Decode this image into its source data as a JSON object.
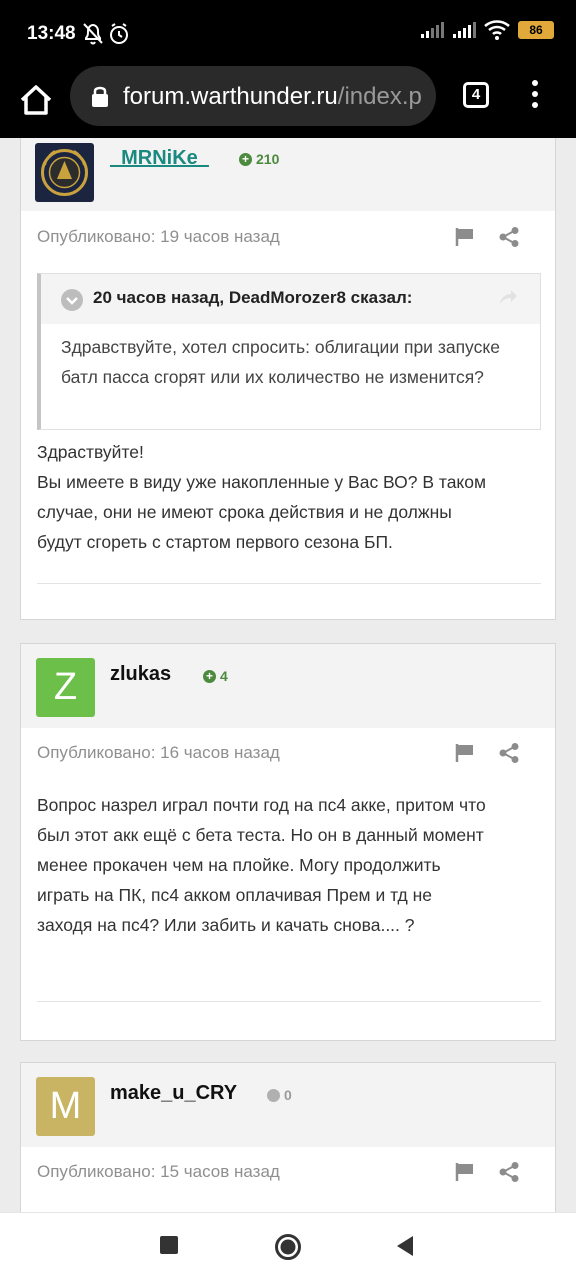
{
  "status_bar": {
    "time": "13:48",
    "battery": "86",
    "icons": [
      "bell-off-icon",
      "alarm-icon",
      "signal-icon",
      "signal-icon",
      "wifi-icon",
      "battery-icon"
    ]
  },
  "browser": {
    "url_host": "forum.warthunder.ru",
    "url_path": "/index.p",
    "tab_count": "4"
  },
  "posts": [
    {
      "username": "_MRNiKe_",
      "username_color": "#1a8a80",
      "reputation": "210",
      "rep_color": "#4c8a3e",
      "published": "Опубликовано: 19 часов назад",
      "quote": {
        "title": "20 часов назад, DeadMorozer8 сказал:",
        "text": "Здравствуйте, хотел спросить: облигации при запуске батл пасса сгорят или их количество не изменится?"
      },
      "body_lines": [
        "Здраствуйте!",
        "Вы имеете в виду уже накопленные у Вас ВО? В таком",
        "случае, они не имеют срока действия и не должны",
        "будут сгореть с стартом первого сезона БП."
      ]
    },
    {
      "username": "zlukas",
      "avatar_letter": "Z",
      "avatar_color": "#6cc04a",
      "reputation": "4",
      "rep_color": "#4c8a3e",
      "published": "Опубликовано: 16 часов назад",
      "body_lines": [
        "Вопрос назрел играл почти год на пс4 акке, притом что",
        "был этот акк ещё с бета теста. Но он в данный момент",
        "менее прокачен чем на плойке. Могу продолжить",
        "играть на ПК, пс4 акком оплачивая Прем и тд не",
        "заходя на пс4? Или забить и качать снова.... ?"
      ]
    },
    {
      "username": "make_u_CRY",
      "avatar_letter": "M",
      "avatar_color": "#c8b462",
      "reputation": "0",
      "rep_color": "#9a9a9a",
      "published": "Опубликовано: 15 часов назад"
    }
  ],
  "nav": [
    "recents-button",
    "home-button",
    "back-button"
  ]
}
